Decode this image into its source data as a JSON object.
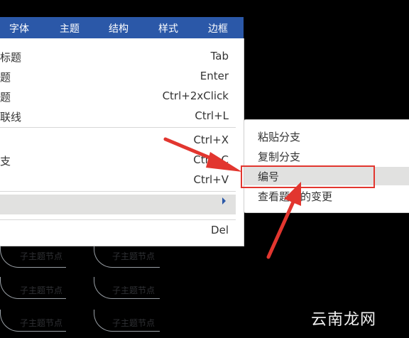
{
  "menubar": {
    "items": [
      "字体",
      "主题",
      "结构",
      "样式",
      "边框"
    ]
  },
  "dropdown": {
    "rows": [
      {
        "label": "标题",
        "shortcut": "Tab"
      },
      {
        "label": "题",
        "shortcut": "Enter"
      },
      {
        "label": "题",
        "shortcut": "Ctrl+2xClick"
      },
      {
        "label": "联线",
        "shortcut": "Ctrl+L"
      },
      {
        "label": "",
        "shortcut": "Ctrl+X"
      },
      {
        "label": "支",
        "shortcut": "Ctrl+C"
      },
      {
        "label": "",
        "shortcut": "Ctrl+V"
      },
      {
        "label": "",
        "shortcut": ""
      },
      {
        "label": "",
        "shortcut": "Del"
      }
    ]
  },
  "submenu": {
    "items": [
      "粘贴分支",
      "复制分支",
      "编号",
      "查看题目的变更"
    ]
  },
  "canvas": {
    "nodes": [
      "子主题节点",
      "子主题节点",
      "子主题节点",
      "子主题节点",
      "子主题节点",
      "子主题节点"
    ]
  },
  "watermark": "云南龙网",
  "colors": {
    "menubar": "#2b58a8",
    "highlight": "#e1e1e0",
    "annotation": "#e2362f"
  }
}
